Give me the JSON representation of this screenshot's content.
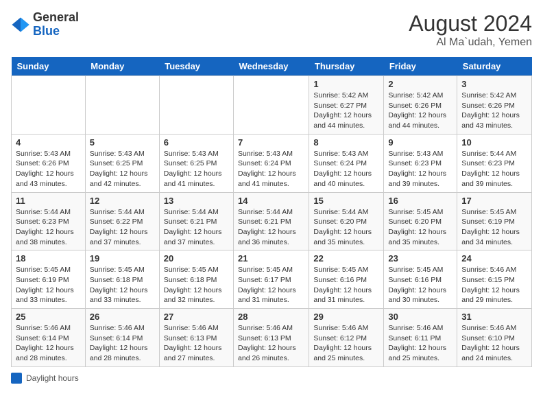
{
  "header": {
    "logo_general": "General",
    "logo_blue": "Blue",
    "month_year": "August 2024",
    "location": "Al Ma`udah, Yemen"
  },
  "legend": {
    "color_label": "Daylight hours"
  },
  "days_of_week": [
    "Sunday",
    "Monday",
    "Tuesday",
    "Wednesday",
    "Thursday",
    "Friday",
    "Saturday"
  ],
  "weeks": [
    [
      {
        "day": "",
        "info": ""
      },
      {
        "day": "",
        "info": ""
      },
      {
        "day": "",
        "info": ""
      },
      {
        "day": "",
        "info": ""
      },
      {
        "day": "1",
        "info": "Sunrise: 5:42 AM\nSunset: 6:27 PM\nDaylight: 12 hours and 44 minutes."
      },
      {
        "day": "2",
        "info": "Sunrise: 5:42 AM\nSunset: 6:26 PM\nDaylight: 12 hours and 44 minutes."
      },
      {
        "day": "3",
        "info": "Sunrise: 5:42 AM\nSunset: 6:26 PM\nDaylight: 12 hours and 43 minutes."
      }
    ],
    [
      {
        "day": "4",
        "info": "Sunrise: 5:43 AM\nSunset: 6:26 PM\nDaylight: 12 hours and 43 minutes."
      },
      {
        "day": "5",
        "info": "Sunrise: 5:43 AM\nSunset: 6:25 PM\nDaylight: 12 hours and 42 minutes."
      },
      {
        "day": "6",
        "info": "Sunrise: 5:43 AM\nSunset: 6:25 PM\nDaylight: 12 hours and 41 minutes."
      },
      {
        "day": "7",
        "info": "Sunrise: 5:43 AM\nSunset: 6:24 PM\nDaylight: 12 hours and 41 minutes."
      },
      {
        "day": "8",
        "info": "Sunrise: 5:43 AM\nSunset: 6:24 PM\nDaylight: 12 hours and 40 minutes."
      },
      {
        "day": "9",
        "info": "Sunrise: 5:43 AM\nSunset: 6:23 PM\nDaylight: 12 hours and 39 minutes."
      },
      {
        "day": "10",
        "info": "Sunrise: 5:44 AM\nSunset: 6:23 PM\nDaylight: 12 hours and 39 minutes."
      }
    ],
    [
      {
        "day": "11",
        "info": "Sunrise: 5:44 AM\nSunset: 6:23 PM\nDaylight: 12 hours and 38 minutes."
      },
      {
        "day": "12",
        "info": "Sunrise: 5:44 AM\nSunset: 6:22 PM\nDaylight: 12 hours and 37 minutes."
      },
      {
        "day": "13",
        "info": "Sunrise: 5:44 AM\nSunset: 6:21 PM\nDaylight: 12 hours and 37 minutes."
      },
      {
        "day": "14",
        "info": "Sunrise: 5:44 AM\nSunset: 6:21 PM\nDaylight: 12 hours and 36 minutes."
      },
      {
        "day": "15",
        "info": "Sunrise: 5:44 AM\nSunset: 6:20 PM\nDaylight: 12 hours and 35 minutes."
      },
      {
        "day": "16",
        "info": "Sunrise: 5:45 AM\nSunset: 6:20 PM\nDaylight: 12 hours and 35 minutes."
      },
      {
        "day": "17",
        "info": "Sunrise: 5:45 AM\nSunset: 6:19 PM\nDaylight: 12 hours and 34 minutes."
      }
    ],
    [
      {
        "day": "18",
        "info": "Sunrise: 5:45 AM\nSunset: 6:19 PM\nDaylight: 12 hours and 33 minutes."
      },
      {
        "day": "19",
        "info": "Sunrise: 5:45 AM\nSunset: 6:18 PM\nDaylight: 12 hours and 33 minutes."
      },
      {
        "day": "20",
        "info": "Sunrise: 5:45 AM\nSunset: 6:18 PM\nDaylight: 12 hours and 32 minutes."
      },
      {
        "day": "21",
        "info": "Sunrise: 5:45 AM\nSunset: 6:17 PM\nDaylight: 12 hours and 31 minutes."
      },
      {
        "day": "22",
        "info": "Sunrise: 5:45 AM\nSunset: 6:16 PM\nDaylight: 12 hours and 31 minutes."
      },
      {
        "day": "23",
        "info": "Sunrise: 5:45 AM\nSunset: 6:16 PM\nDaylight: 12 hours and 30 minutes."
      },
      {
        "day": "24",
        "info": "Sunrise: 5:46 AM\nSunset: 6:15 PM\nDaylight: 12 hours and 29 minutes."
      }
    ],
    [
      {
        "day": "25",
        "info": "Sunrise: 5:46 AM\nSunset: 6:14 PM\nDaylight: 12 hours and 28 minutes."
      },
      {
        "day": "26",
        "info": "Sunrise: 5:46 AM\nSunset: 6:14 PM\nDaylight: 12 hours and 28 minutes."
      },
      {
        "day": "27",
        "info": "Sunrise: 5:46 AM\nSunset: 6:13 PM\nDaylight: 12 hours and 27 minutes."
      },
      {
        "day": "28",
        "info": "Sunrise: 5:46 AM\nSunset: 6:13 PM\nDaylight: 12 hours and 26 minutes."
      },
      {
        "day": "29",
        "info": "Sunrise: 5:46 AM\nSunset: 6:12 PM\nDaylight: 12 hours and 25 minutes."
      },
      {
        "day": "30",
        "info": "Sunrise: 5:46 AM\nSunset: 6:11 PM\nDaylight: 12 hours and 25 minutes."
      },
      {
        "day": "31",
        "info": "Sunrise: 5:46 AM\nSunset: 6:10 PM\nDaylight: 12 hours and 24 minutes."
      }
    ]
  ]
}
